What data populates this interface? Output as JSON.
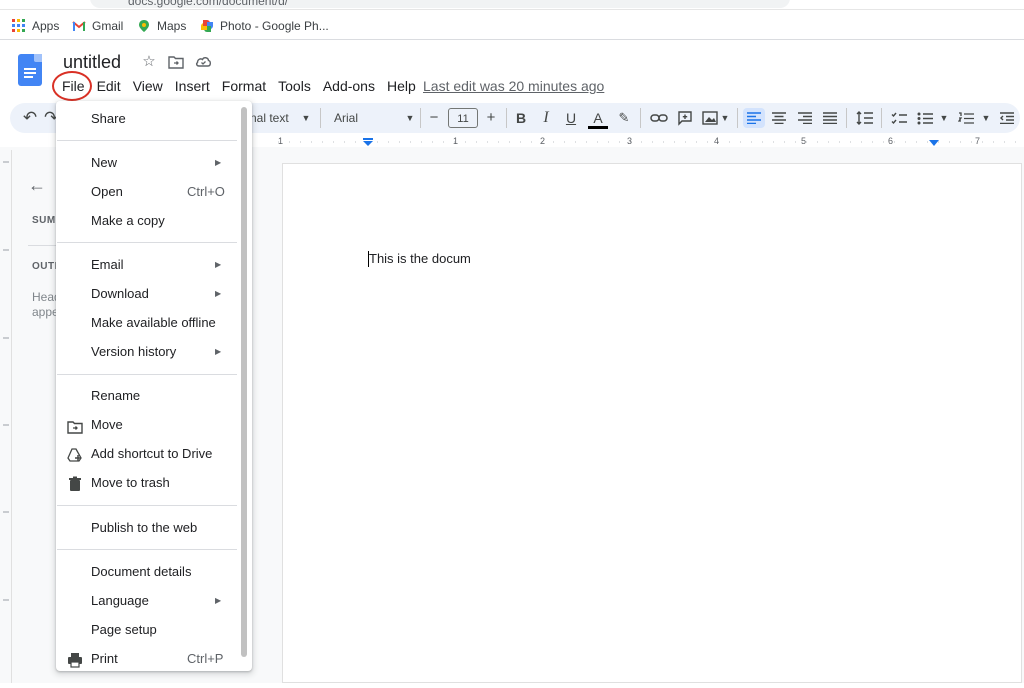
{
  "browser": {
    "url_fragment": "docs.google.com/document/d/"
  },
  "bookmarks": [
    {
      "label": "Apps",
      "icon": "apps-grid-icon"
    },
    {
      "label": "Gmail",
      "icon": "gmail-icon"
    },
    {
      "label": "Maps",
      "icon": "maps-pin-icon"
    },
    {
      "label": "Photo - Google Ph...",
      "icon": "photos-pinwheel-icon"
    }
  ],
  "doc": {
    "title": "untitled",
    "last_edit": "Last edit was 20 minutes ago",
    "body_text": "This is the docum"
  },
  "menubar": [
    "File",
    "Edit",
    "View",
    "Insert",
    "Format",
    "Tools",
    "Add-ons",
    "Help"
  ],
  "toolbar": {
    "style": "nal text",
    "font": "Arial",
    "font_size": "11",
    "bold": "B",
    "italic": "I",
    "underline": "U",
    "text_color": "A",
    "decrease": "−",
    "increase": "+"
  },
  "ruler": {
    "numbers": [
      "1",
      "1",
      "2",
      "3",
      "4",
      "5",
      "6",
      "7"
    ]
  },
  "outline": {
    "summary": "SUM",
    "outline": "OUTL",
    "hint_line1": "Head",
    "hint_line2": "appe"
  },
  "file_menu": {
    "share": "Share",
    "new": "New",
    "open": "Open",
    "open_shortcut": "Ctrl+O",
    "make_copy": "Make a copy",
    "email": "Email",
    "download": "Download",
    "offline": "Make available offline",
    "version_history": "Version history",
    "rename": "Rename",
    "move": "Move",
    "add_shortcut": "Add shortcut to Drive",
    "move_trash": "Move to trash",
    "publish": "Publish to the web",
    "details": "Document details",
    "language": "Language",
    "page_setup": "Page setup",
    "print": "Print",
    "print_shortcut": "Ctrl+P"
  },
  "colors": {
    "accent": "#1a73e8",
    "file_circle": "#d93025",
    "docs_blue": "#4285f4"
  }
}
